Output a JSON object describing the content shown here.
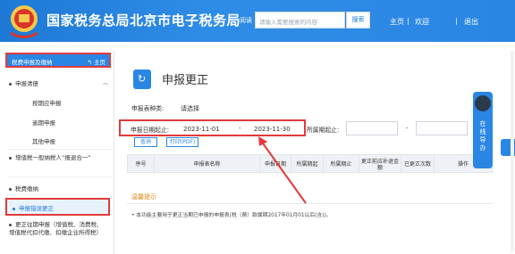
{
  "header": {
    "site_title": "国家税务总局北京市电子税务局",
    "lang_label": "阅读",
    "search_placeholder": "请输入需要搜索的内容",
    "search_button": "搜索",
    "nav_home": "主页",
    "nav_sep1": "|",
    "nav_welcome": "欢迎",
    "nav_sep2": "|",
    "nav_logout": "退出"
  },
  "sidebar": {
    "title": "税费申报及缴纳",
    "home_link": "主页",
    "items": [
      {
        "label": "申报清册"
      },
      {
        "label": "按期应申报"
      },
      {
        "label": "逾期申报"
      },
      {
        "label": "其他申报"
      },
      {
        "label": "增值税一般纳税人“报退合一”"
      },
      {
        "label": "税费缴纳"
      },
      {
        "label": "申报错误更正"
      },
      {
        "label": "更正往期申报（增值税、消费税、增值税代扣代缴、扣缴企业所得税）"
      }
    ]
  },
  "main": {
    "page_title": "申报更正",
    "form": {
      "report_type_label": "申报表种类:",
      "report_type_value": "请选择",
      "period_label": "申报日期起止:",
      "date_start": "2023-11-01",
      "date_sep": "-",
      "date_end": "2023-11-30",
      "belong_label": "所属期起止:",
      "belong_start": "",
      "belong_sep": "-",
      "belong_end": ""
    },
    "buttons": {
      "query": "查询",
      "print": "打印(PDF)"
    },
    "table_headers": [
      "序号",
      "申报表名称",
      "申报日期",
      "所属期起",
      "所属期止",
      "更正前应补退金额",
      "已更正次数",
      "操作"
    ],
    "warm_tip_title": "温馨提示",
    "warm_tip_text": "• 本功能主要用于更正当期已申报的申报表(税（费）款属期2017年01月01以后(含))。"
  },
  "float_panel": {
    "text": "在线导办"
  },
  "colors": {
    "brand_blue": "#2a86e3",
    "highlight_red": "#e23a3a",
    "tip_orange": "#e08a1c"
  }
}
